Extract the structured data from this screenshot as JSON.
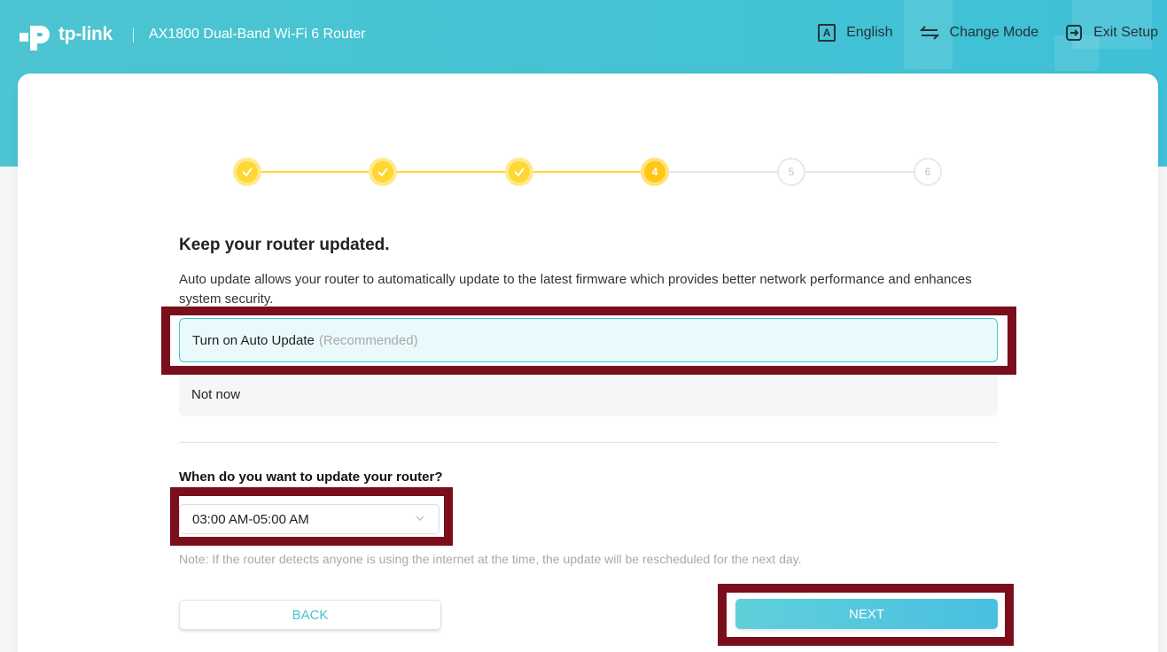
{
  "header": {
    "brand": "tp-link",
    "model": "AX1800 Dual-Band Wi-Fi 6 Router",
    "actions": [
      {
        "label": "English",
        "icon": "language-icon"
      },
      {
        "label": "Change Mode",
        "icon": "swap-arrows-icon"
      },
      {
        "label": "Exit Setup",
        "icon": "exit-icon"
      }
    ]
  },
  "stepper": {
    "steps": [
      {
        "state": "done"
      },
      {
        "state": "done"
      },
      {
        "state": "done"
      },
      {
        "state": "active",
        "label": "4"
      },
      {
        "state": "todo",
        "label": "5"
      },
      {
        "state": "todo",
        "label": "6"
      }
    ],
    "colors": {
      "done": "#ffd632",
      "active": "#ffc817",
      "todo_line": "#e6e6e6"
    }
  },
  "content": {
    "title": "Keep your router updated.",
    "description": "Auto update allows your router to automatically update to the latest firmware which provides better network performance and enhances system security.",
    "options": [
      {
        "label": "Turn on Auto Update",
        "hint": "(Recommended)",
        "selected": true
      },
      {
        "label": "Not now",
        "selected": false
      }
    ],
    "schedule_question": "When do you want to update your router?",
    "schedule_value": "03:00 AM-05:00 AM",
    "note": "Note: If the router detects anyone is using the internet at the time, the update will be rescheduled for the next day."
  },
  "buttons": {
    "back": "BACK",
    "next": "NEXT"
  },
  "colors": {
    "accent": "#45c3d3",
    "highlight_frame": "#7a0e1b"
  }
}
